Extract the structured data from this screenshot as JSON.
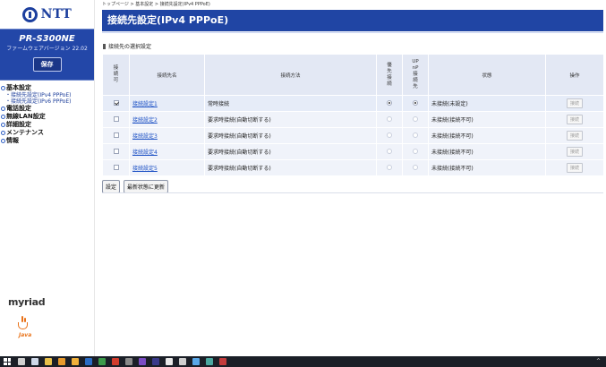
{
  "sidebar": {
    "logo_text": "NTT",
    "model_name": "PR-S300NE",
    "firmware_version": "ファームウェアバージョン 22.02",
    "save_label": "保存",
    "nav": [
      {
        "label": "基本設定",
        "children": [
          "接続先設定(IPv4 PPPoE)",
          "接続先設定(IPv6 PPPoE)"
        ]
      },
      {
        "label": "電話設定",
        "children": []
      },
      {
        "label": "無線LAN設定",
        "children": []
      },
      {
        "label": "詳細設定",
        "children": []
      },
      {
        "label": "メンテナンス",
        "children": []
      },
      {
        "label": "情報",
        "children": []
      }
    ],
    "myriad_label": "myriad",
    "java_label": "Java"
  },
  "main": {
    "breadcrumb": "トップページ > 基本設定 > 接続先設定(IPv4 PPPoE)",
    "page_title": "接続先設定(IPv4 PPPoE)",
    "section_title": "接続先の選択設定",
    "table": {
      "headers": {
        "enabled": "接続可",
        "name": "接続先名",
        "method": "接続方法",
        "priority": "優先接続",
        "upnp": "UPnP接続先",
        "status": "状態",
        "operation": "操作"
      },
      "rows": [
        {
          "enabled": true,
          "name": "接続設定1",
          "method": "常時接続",
          "priority": true,
          "upnp": true,
          "status": "未接続(未設定)",
          "operation": "接続"
        },
        {
          "enabled": false,
          "name": "接続設定2",
          "method": "要求時接続(自動切断する)",
          "priority": false,
          "upnp": false,
          "status": "未接続(接続不可)",
          "operation": "接続"
        },
        {
          "enabled": false,
          "name": "接続設定3",
          "method": "要求時接続(自動切断する)",
          "priority": false,
          "upnp": false,
          "status": "未接続(接続不可)",
          "operation": "接続"
        },
        {
          "enabled": false,
          "name": "接続設定4",
          "method": "要求時接続(自動切断する)",
          "priority": false,
          "upnp": false,
          "status": "未接続(接続不可)",
          "operation": "接続"
        },
        {
          "enabled": false,
          "name": "接続設定5",
          "method": "要求時接続(自動切断する)",
          "priority": false,
          "upnp": false,
          "status": "未接続(接続不可)",
          "operation": "接続"
        }
      ]
    },
    "actions": {
      "set_label": "設定",
      "refresh_label": "最新状態に更新"
    }
  },
  "taskbar": {
    "icons": [
      "windows-start-icon",
      "search-icon",
      "task-view-icon",
      "file-explorer-icon",
      "app-icon-yellow",
      "app-icon-orange",
      "app-icon-blue",
      "app-icon-green",
      "app-icon-red",
      "app-icon-gray",
      "app-icon-purple",
      "app-icon-dark",
      "browser-icon",
      "settings-icon",
      "app-icon-lightblue",
      "app-icon-teal",
      "app-icon-red2"
    ],
    "colors": [
      "#ffffff",
      "#d0d0d0",
      "#cfd8e8",
      "#e8c04a",
      "#e89a2c",
      "#f0b03a",
      "#2a6cc4",
      "#3c9a4a",
      "#d23c2c",
      "#8a8a8a",
      "#7a4cc4",
      "#3a3a8a",
      "#e8e8e8",
      "#cfcfcf",
      "#5aa8e8",
      "#4aa8a0",
      "#c43c3c"
    ]
  }
}
